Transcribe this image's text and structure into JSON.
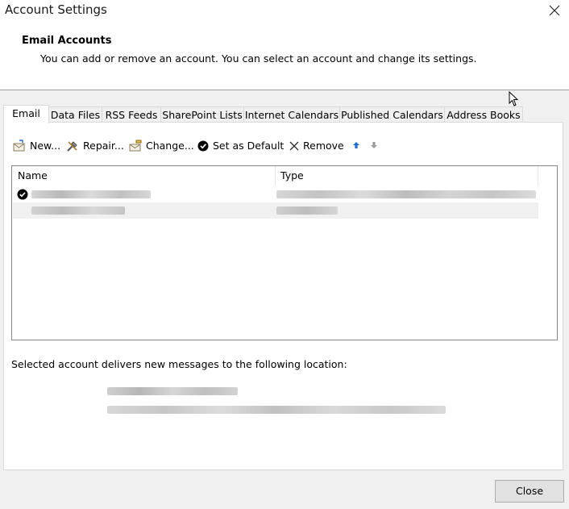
{
  "window": {
    "title": "Account Settings"
  },
  "header": {
    "title": "Email Accounts",
    "subtitle": "You can add or remove an account. You can select an account and change its settings."
  },
  "tabs": [
    {
      "label": "Email",
      "active": true
    },
    {
      "label": "Data Files"
    },
    {
      "label": "RSS Feeds"
    },
    {
      "label": "SharePoint Lists"
    },
    {
      "label": "Internet Calendars"
    },
    {
      "label": "Published Calendars"
    },
    {
      "label": "Address Books"
    }
  ],
  "toolbar": {
    "new_label": "New...",
    "repair_label": "Repair...",
    "change_label": "Change...",
    "set_default_label": "Set as Default",
    "remove_label": "Remove"
  },
  "list": {
    "columns": [
      "Name",
      "Type"
    ]
  },
  "location": {
    "label": "Selected account delivers new messages to the following location:"
  },
  "footer": {
    "close_label": "Close"
  },
  "colors": {
    "accent_blue": "#1e6ed6",
    "window_bg": "#f0f0f0",
    "panel_bg": "#ffffff",
    "blur_gray": "#c8c8c8"
  }
}
